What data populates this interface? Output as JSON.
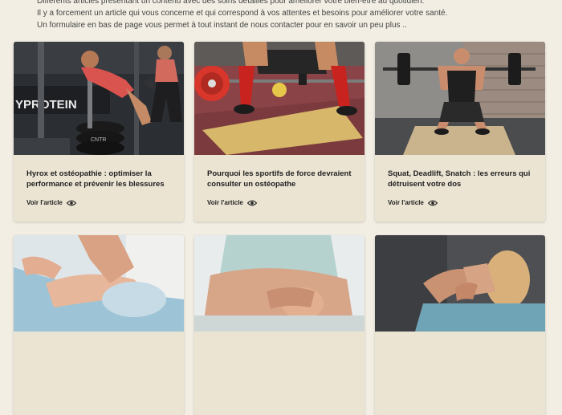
{
  "intro": {
    "line1": "Différents articles présentant un contenu avec des soins détaillés pour améliorer votre bien-être au quotidien.",
    "line2": "Il y a forcement un article qui vous concerne et qui correspond à vos attentes et besoins pour améliorer votre santé.",
    "line3": "Un formulaire en bas de page vous permet à tout instant de nous contacter pour en savoir un peu plus .."
  },
  "articles": [
    {
      "title": "Hyrox et ostéopathie : optimiser la performance et prévenir les blessures",
      "link": "Voir l'article"
    },
    {
      "title": "Pourquoi les sportifs de force devraient consulter un ostéopathe",
      "link": "Voir l'article"
    },
    {
      "title": "Squat, Deadlift, Snatch : les erreurs qui détruisent votre dos",
      "link": "Voir l'article"
    }
  ],
  "photo_text": {
    "gym_sign": "YPROTEIN",
    "plate_label": "CNTR"
  },
  "icons": {
    "view": "eye-icon"
  },
  "colors": {
    "background": "#f2eee3",
    "card": "#ebe4d3",
    "plate_red": "#d9362b"
  }
}
